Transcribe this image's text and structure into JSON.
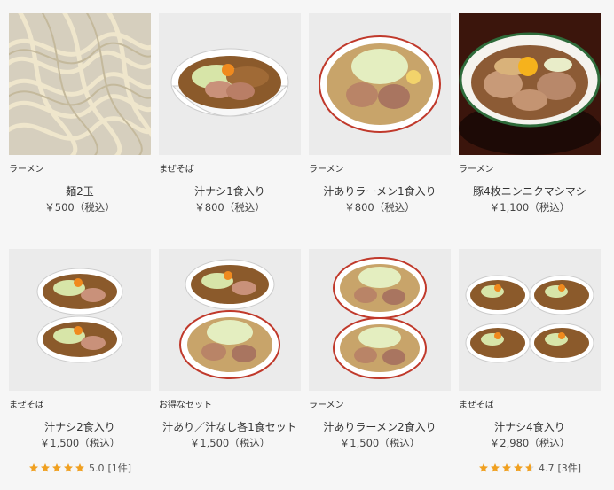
{
  "products": [
    {
      "category": "ラーメン",
      "name": "麺2玉",
      "price": "￥500（税込）",
      "image": "noodles-image"
    },
    {
      "category": "まぜそば",
      "name": "汁ナシ1食入り",
      "price": "￥800（税込）",
      "image": "single-bowl-mazesoba"
    },
    {
      "category": "ラーメン",
      "name": "汁ありラーメン1食入り",
      "price": "￥800（税込）",
      "image": "single-bowl-ramen"
    },
    {
      "category": "ラーメン",
      "name": "豚4枚ニンニクマシマシ",
      "price": "￥1,100（税込）",
      "image": "pork-garlic-bowl"
    },
    {
      "category": "まぜそば",
      "name": "汁ナシ2食入り",
      "price": "￥1,500（税込）",
      "image": "two-bowls-mazesoba",
      "rating": {
        "value": 5.0,
        "label": "5.0",
        "count": "[1件]"
      }
    },
    {
      "category": "お得なセット",
      "name": "汁あり／汁なし各1食セット",
      "price": "￥1,500（税込）",
      "image": "mixed-set-bowls"
    },
    {
      "category": "ラーメン",
      "name": "汁ありラーメン2食入り",
      "price": "￥1,500（税込）",
      "image": "two-bowls-ramen"
    },
    {
      "category": "まぜそば",
      "name": "汁ナシ4食入り",
      "price": "￥2,980（税込）",
      "image": "four-bowls-mazesoba",
      "rating": {
        "value": 4.7,
        "label": "4.7",
        "count": "[3件]"
      }
    }
  ],
  "colors": {
    "star": "#f0a020",
    "star_empty": "#d8d8d8",
    "background": "#f6f6f6"
  }
}
